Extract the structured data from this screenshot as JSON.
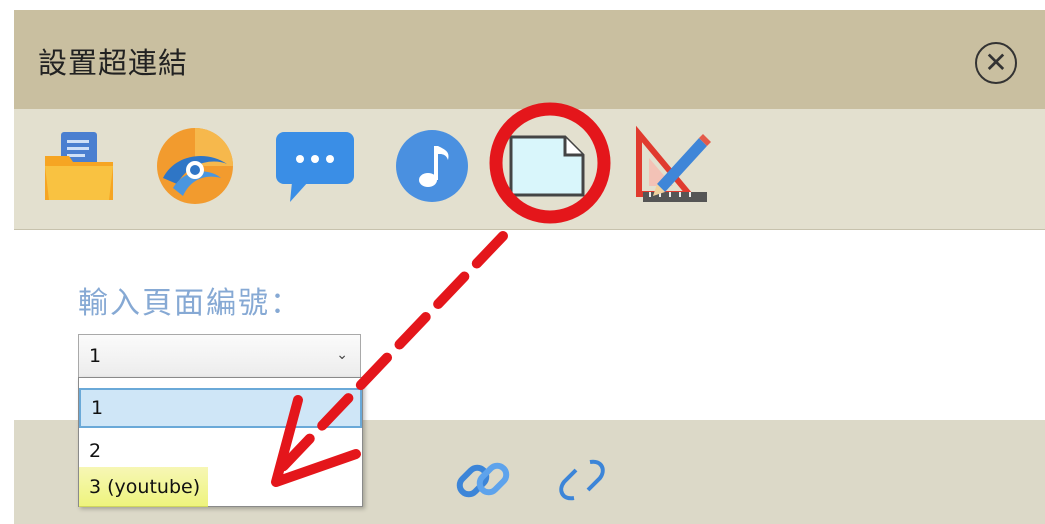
{
  "dialog": {
    "title": "設置超連結",
    "close_icon": "close-circle-icon"
  },
  "toolbar": {
    "tools": [
      {
        "name": "file-folder-icon"
      },
      {
        "name": "web-link-icon"
      },
      {
        "name": "chat-bubble-icon"
      },
      {
        "name": "music-note-icon"
      },
      {
        "name": "page-icon",
        "highlighted": true
      },
      {
        "name": "ruler-pencil-icon"
      }
    ]
  },
  "page_field": {
    "label": "輸入頁面編號：",
    "selected_value": "1",
    "options": [
      "1",
      "2",
      "3 (youtube)"
    ]
  },
  "footer": {
    "icons": [
      "link-icon",
      "unlink-icon"
    ]
  },
  "annotation": {
    "circle_color": "#e4161b",
    "arrow_color": "#e4161b",
    "highlight_color": "#ecf04a"
  }
}
